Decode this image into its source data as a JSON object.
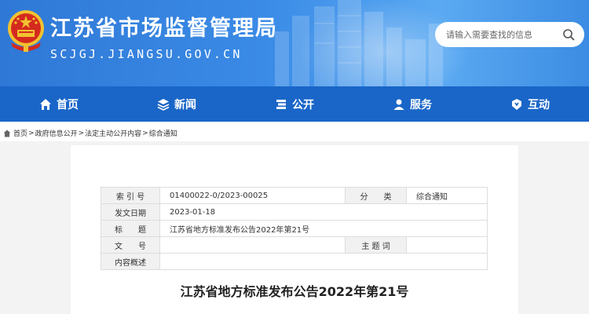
{
  "header": {
    "title": "江苏省市场监督管理局",
    "url": "SCJGJ.JIANGSU.GOV.CN",
    "search_placeholder": "请输入需要查找的信息"
  },
  "nav": [
    {
      "label": "首页",
      "icon": "home-icon"
    },
    {
      "label": "新闻",
      "icon": "layers-icon"
    },
    {
      "label": "公开",
      "icon": "stack-icon"
    },
    {
      "label": "服务",
      "icon": "user-icon"
    },
    {
      "label": "互动",
      "icon": "hand-icon"
    }
  ],
  "breadcrumb": [
    "首页",
    "政府信息公开",
    "法定主动公开内容",
    "综合通知"
  ],
  "breadcrumb_sep": ">",
  "meta": {
    "index_label": "索 引 号",
    "index_value": "01400022-0/2023-00025",
    "category_label": "分　　类",
    "category_value": "综合通知",
    "date_label": "发文日期",
    "date_value": "2023-01-18",
    "title_label": "标　　题",
    "title_value": "江苏省地方标准发布公告2022年第21号",
    "docno_label": "文　　号",
    "docno_value": "",
    "topic_label": "主 题 词",
    "topic_value": "",
    "summary_label": "内容概述",
    "summary_value": ""
  },
  "document_title": "江苏省地方标准发布公告2022年第21号",
  "colors": {
    "nav_bg": "#1a66c8",
    "banner": "#3a8be6",
    "emblem_red": "#d42a1e",
    "emblem_gold": "#f2c230"
  }
}
